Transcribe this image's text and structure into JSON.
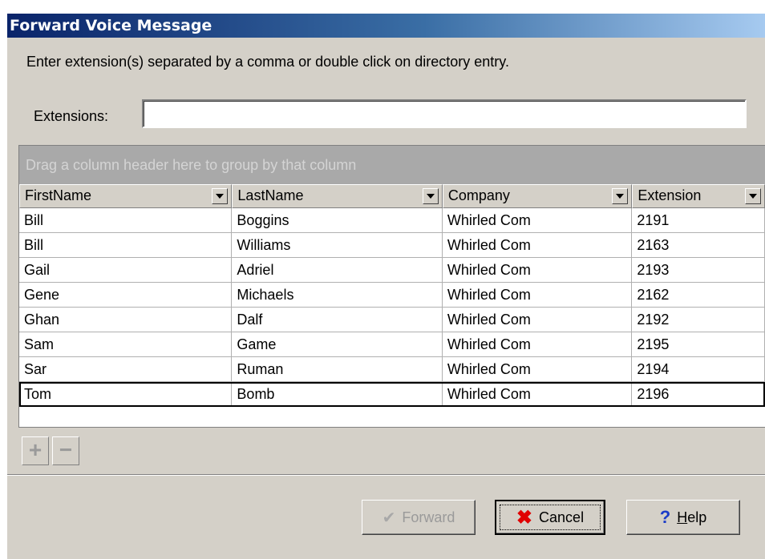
{
  "window": {
    "title": "Forward Voice Message"
  },
  "instructions": "Enter extension(s) separated by a comma or double click on directory entry.",
  "extensions": {
    "label": "Extensions:",
    "value": ""
  },
  "grid": {
    "group_hint": "Drag a column header here to group by that column",
    "columns": [
      "FirstName",
      "LastName",
      "Company",
      "Extension"
    ],
    "rows": [
      [
        "Bill",
        "Boggins",
        "Whirled Com",
        "2191"
      ],
      [
        "Bill",
        "Williams",
        "Whirled Com",
        "2163"
      ],
      [
        "Gail",
        "Adriel",
        "Whirled Com",
        "2193"
      ],
      [
        "Gene",
        "Michaels",
        "Whirled Com",
        "2162"
      ],
      [
        "Ghan",
        "Dalf",
        "Whirled Com",
        "2192"
      ],
      [
        "Sam",
        "Game",
        "Whirled Com",
        "2195"
      ],
      [
        "Sar",
        "Ruman",
        "Whirled Com",
        "2194"
      ],
      [
        "Tom",
        "Bomb",
        "Whirled Com",
        "2196"
      ]
    ],
    "selected_row": 7
  },
  "nav": {
    "add_label": "+",
    "remove_label": "−"
  },
  "buttons": {
    "forward": {
      "label": "Forward",
      "icon": "checkmarks-icon",
      "enabled": false
    },
    "cancel": {
      "label": "Cancel",
      "icon": "red-x-icon"
    },
    "help": {
      "label_accel": "H",
      "label_rest": "elp",
      "icon": "question-mark-icon"
    }
  },
  "colors": {
    "title_start": "#0a246a",
    "title_end": "#a6caf0",
    "dialog_bg": "#d4d0c8",
    "group_area": "#a9a9a9"
  }
}
